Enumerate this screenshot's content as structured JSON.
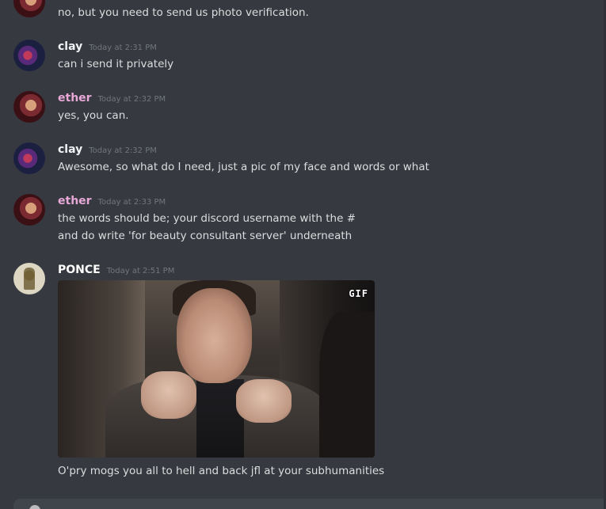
{
  "channel": {
    "messages": [
      {
        "author": "",
        "author_color": "#e8a8d8",
        "avatar": "ether-avatar",
        "timestamp": "",
        "lines": [
          "no, but you need to send us photo verification."
        ]
      },
      {
        "author": "clay",
        "author_color": "#f2f3f5",
        "avatar": "clay-avatar",
        "timestamp": "Today at 2:31 PM",
        "lines": [
          "can i send it privately"
        ]
      },
      {
        "author": "ether",
        "author_color": "#e8a8d8",
        "avatar": "ether-avatar",
        "timestamp": "Today at 2:32 PM",
        "lines": [
          "yes, you can."
        ]
      },
      {
        "author": "clay",
        "author_color": "#f2f3f5",
        "avatar": "clay-avatar",
        "timestamp": "Today at 2:32 PM",
        "lines": [
          "Awesome, so what do I need, just a pic of my face and words or what"
        ]
      },
      {
        "author": "ether",
        "author_color": "#e8a8d8",
        "avatar": "ether-avatar",
        "timestamp": "Today at 2:33 PM",
        "lines": [
          "the words should be; your discord username with the #",
          "and do write 'for beauty consultant server' underneath"
        ]
      },
      {
        "author": "PONCE",
        "author_color": "#ffffff",
        "avatar": "ponce-avatar",
        "timestamp": "Today at 2:51 PM",
        "embed": {
          "type": "gif",
          "badge": "GIF"
        },
        "lines": [
          "O'pry mogs you all to hell and back jfl at your subhumanities"
        ]
      }
    ]
  },
  "theme": {
    "background": "#36393f",
    "text": "#dcddde",
    "timestamp": "#72767d"
  }
}
